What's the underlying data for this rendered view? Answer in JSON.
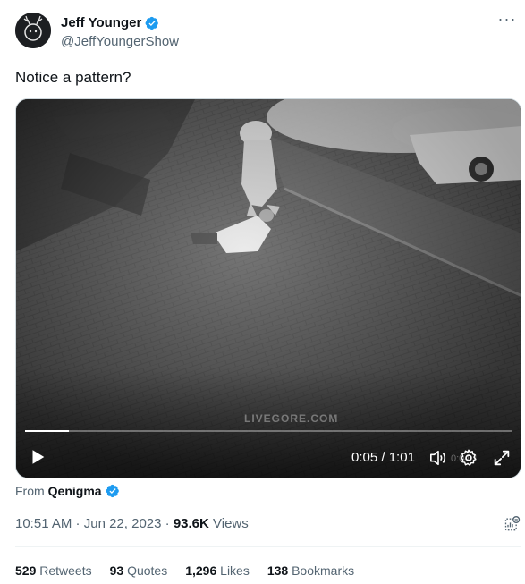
{
  "author": {
    "display_name": "Jeff Younger",
    "handle": "@JeffYoungerShow",
    "verified_badge_icon": "verified-badge-icon"
  },
  "tweet": {
    "text": "Notice a pattern?"
  },
  "video": {
    "watermark": "LIVEGORE.COM",
    "progress": 0.09,
    "time_current": "0:05",
    "time_separator": " / ",
    "time_total": "1:01",
    "ghost_time": "0:04:1"
  },
  "source": {
    "prefix": "From",
    "name": "Qenigma"
  },
  "meta": {
    "time": "10:51 AM",
    "sep1": " · ",
    "date": "Jun 22, 2023",
    "sep2": " · ",
    "views_count": "93.6K",
    "views_label": " Views"
  },
  "stats": [
    {
      "count": "529",
      "label": " Retweets"
    },
    {
      "count": "93",
      "label": " Quotes"
    },
    {
      "count": "1,296",
      "label": " Likes"
    },
    {
      "count": "138",
      "label": " Bookmarks"
    }
  ],
  "colors": {
    "verified_blue": "#1d9bf0",
    "secondary_text": "#536471",
    "primary_text": "#0f1419"
  }
}
